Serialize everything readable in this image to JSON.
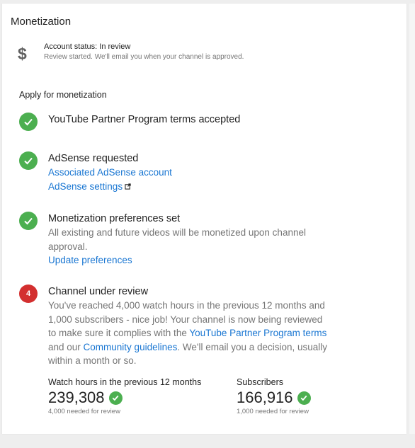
{
  "page": {
    "title": "Monetization"
  },
  "account": {
    "icon": "dollar-icon",
    "status": "Account status: In review",
    "detail": "Review started. We'll email you when your channel is approved."
  },
  "apply": {
    "heading": "Apply for monetization",
    "steps": [
      {
        "state": "done",
        "title": "YouTube Partner Program terms accepted"
      },
      {
        "state": "done",
        "title": "AdSense requested",
        "links": [
          "Associated AdSense account",
          "AdSense settings"
        ]
      },
      {
        "state": "done",
        "title": "Monetization preferences set",
        "text": "All existing and future videos will be monetized upon channel approval.",
        "link": "Update preferences"
      },
      {
        "state": "pending",
        "number": "4",
        "title": "Channel under review",
        "text_parts": [
          "You've reached 4,000 watch hours in the previous 12 months and 1,000 subscribers - nice job! Your channel is now being reviewed to make sure it complies with the ",
          "YouTube Partner Program terms",
          " and our ",
          "Community guidelines",
          ". We'll email you a decision, usually within a month or so."
        ]
      }
    ]
  },
  "stats": {
    "watch_hours": {
      "label": "Watch hours in the previous 12 months",
      "value": "239,308",
      "note": "4,000 needed for review"
    },
    "subscribers": {
      "label": "Subscribers",
      "value": "166,916",
      "note": "1,000 needed for review"
    }
  },
  "colors": {
    "success": "#4caf50",
    "pending": "#d32f2f",
    "link": "#1976d2"
  }
}
